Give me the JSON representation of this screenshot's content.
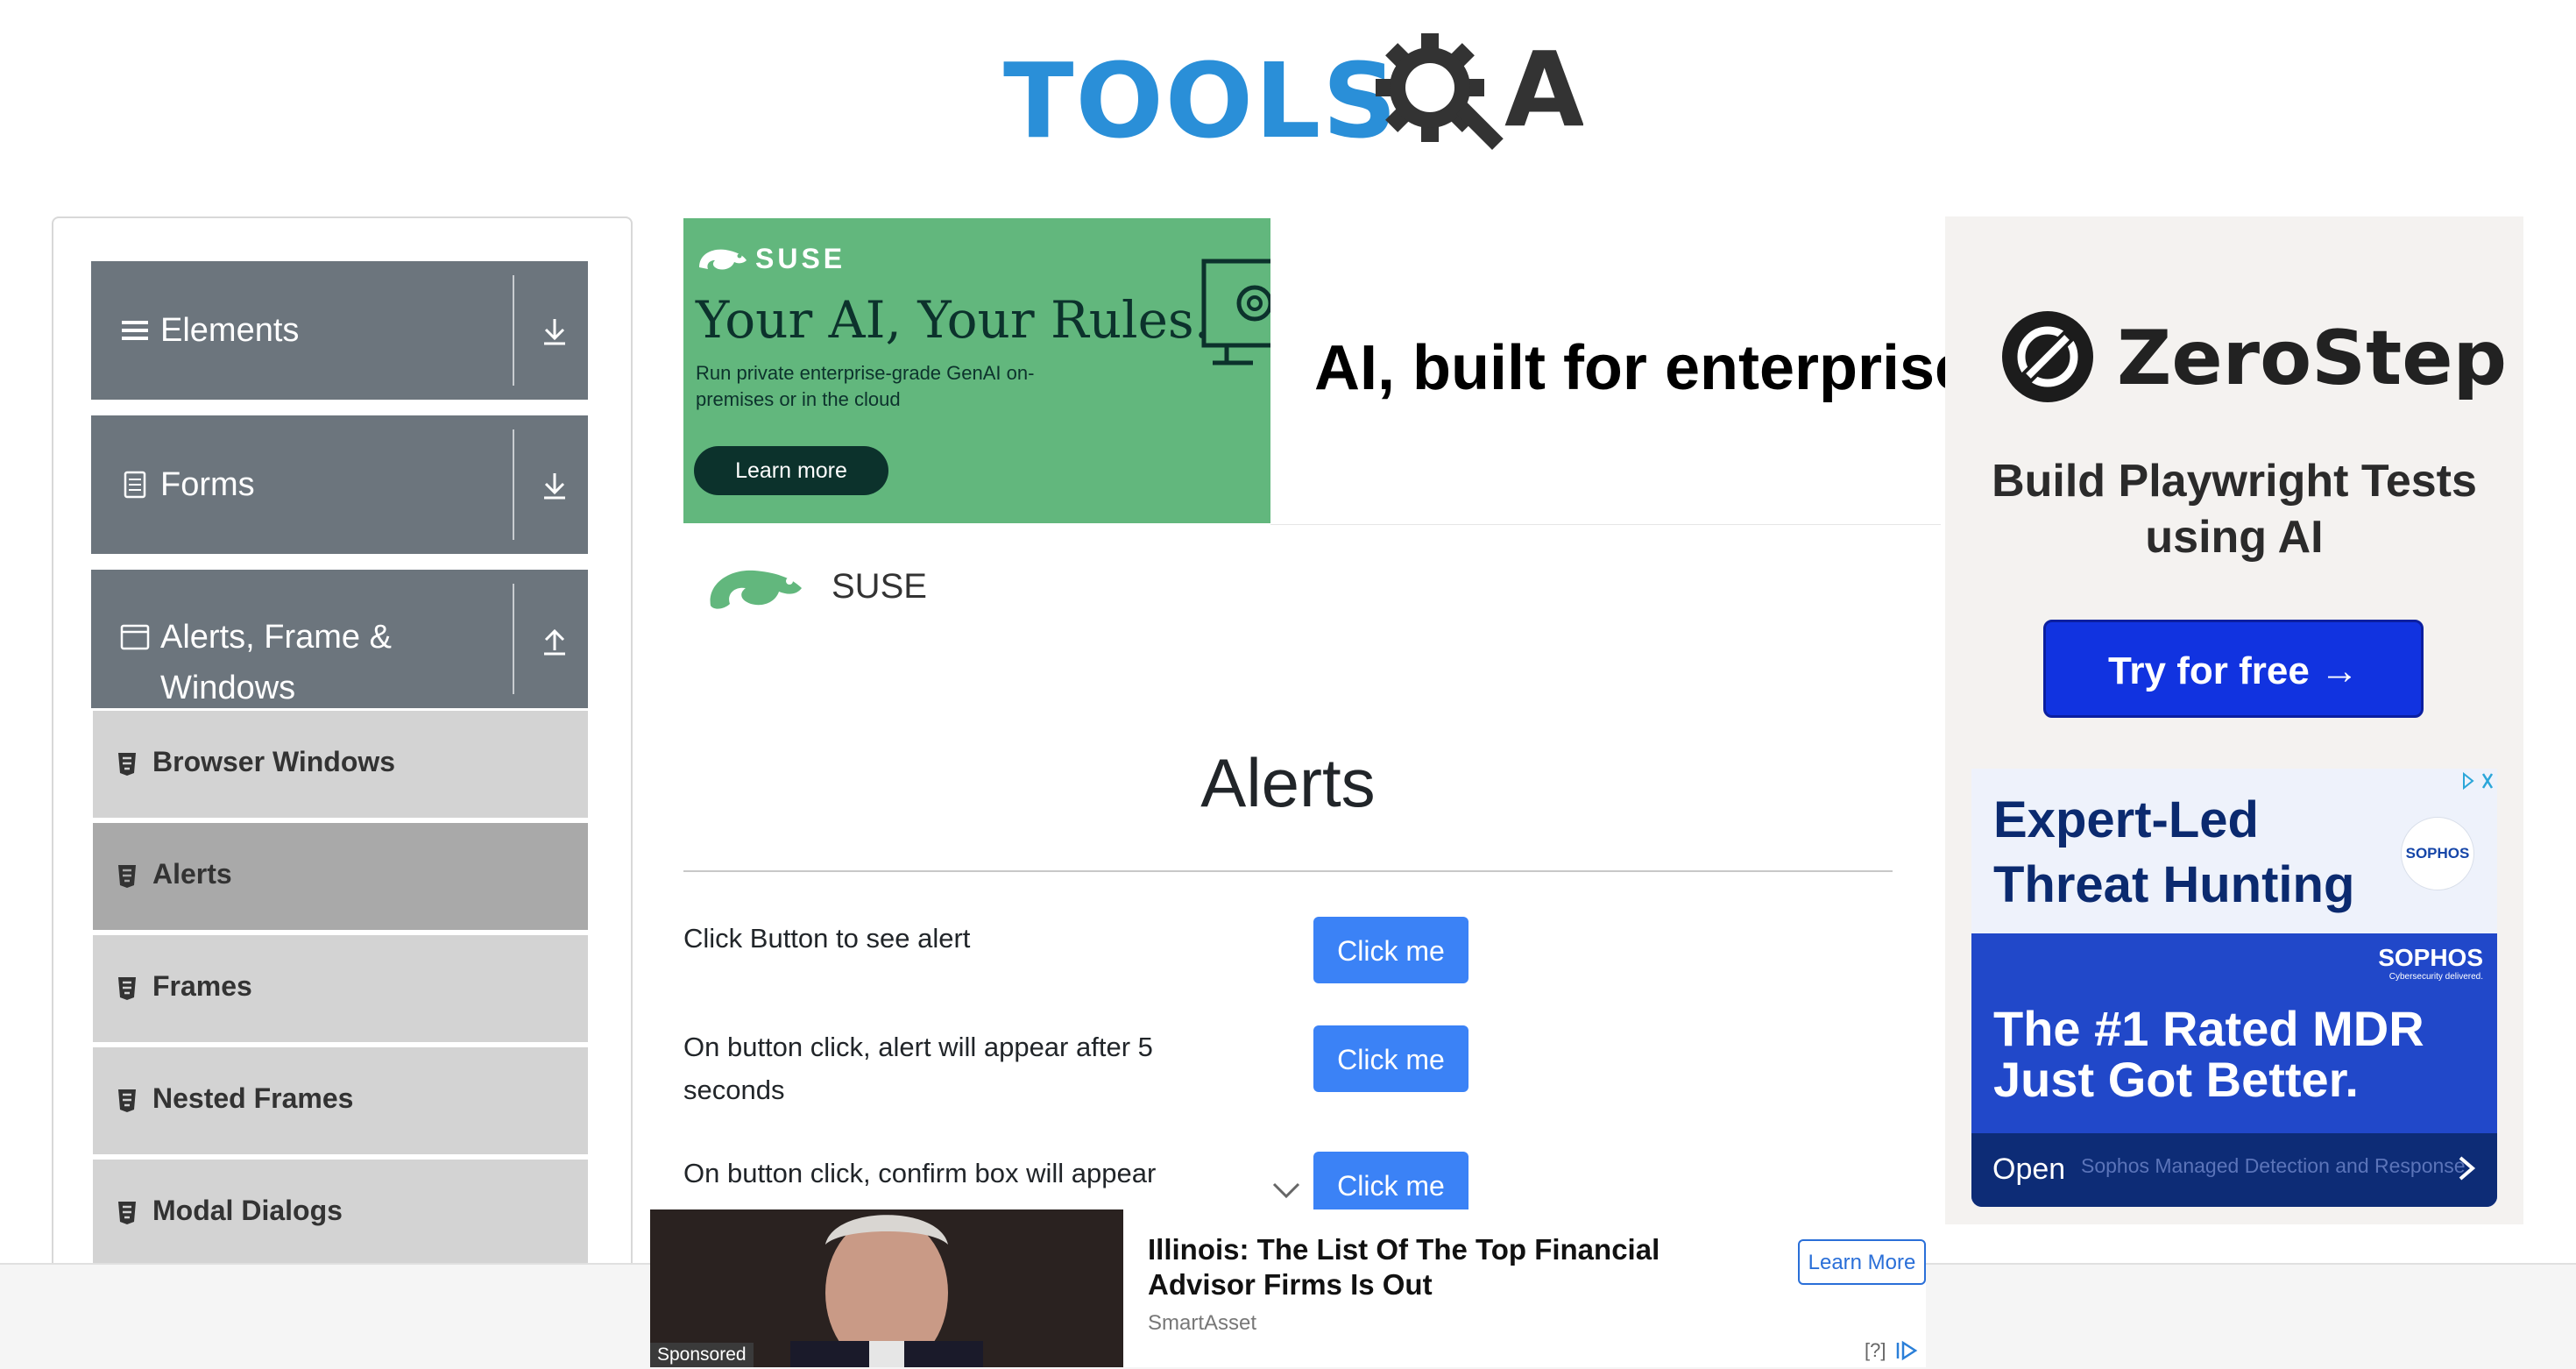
{
  "header": {
    "logo_text": "TOOLS",
    "logo_suffix": "A"
  },
  "sidebar": {
    "groups": [
      {
        "label": "Elements",
        "icon": "hamburger-icon",
        "state": "collapsed"
      },
      {
        "label": "Forms",
        "icon": "document-icon",
        "state": "collapsed"
      },
      {
        "label_line1": "Alerts, Frame &",
        "label_line2": "Windows",
        "icon": "window-icon",
        "state": "expanded"
      }
    ],
    "items": [
      {
        "label": "Browser Windows",
        "active": false
      },
      {
        "label": "Alerts",
        "active": true
      },
      {
        "label": "Frames",
        "active": false
      },
      {
        "label": "Nested Frames",
        "active": false
      },
      {
        "label": "Modal Dialogs",
        "active": false
      }
    ]
  },
  "banner_ad": {
    "brand": "SUSE",
    "headline": "Your AI, Your Rules.",
    "subtext": "Run private enterprise-grade GenAI on-premises or in the cloud",
    "cta": "Learn more",
    "tagline": "AI, built for enterprise",
    "advertiser": "SUSE"
  },
  "main": {
    "title": "Alerts",
    "rows": [
      {
        "label": "Click Button to see alert",
        "button": "Click me"
      },
      {
        "label": "On button click, alert will appear after 5 seconds",
        "button": "Click me"
      },
      {
        "label": "On button click, confirm box will appear",
        "button": "Click me"
      }
    ]
  },
  "right_ad": {
    "zerostep": {
      "name": "ZeroStep",
      "tagline": "Build Playwright Tests using AI",
      "cta": "Try for free →"
    },
    "sophos": {
      "headline": "Expert-Led Threat Hunting",
      "badge": "SOPHOS",
      "brand": "SOPHOS",
      "brand_tagline": "Cybersecurity delivered.",
      "headline2": "The #1 Rated MDR Just Got Better.",
      "cta": "Open",
      "description": "Sophos Managed Detection and Response"
    }
  },
  "bottom_ad": {
    "headline": "Illinois: The List Of The Top Financial Advisor Firms Is Out",
    "source": "SmartAsset",
    "cta": "Learn More",
    "sponsored": "Sponsored",
    "help": "[?]"
  },
  "colors": {
    "sidebar_header": "#6c757d",
    "sidebar_item": "#d3d3d3",
    "sidebar_item_active": "#a9a9a9",
    "primary_button": "#3b82f6",
    "logo_blue": "#2a8fd8",
    "suse_green": "#62b77d",
    "zerostep_button": "#1133e0",
    "sophos_blue": "#2148c9"
  }
}
